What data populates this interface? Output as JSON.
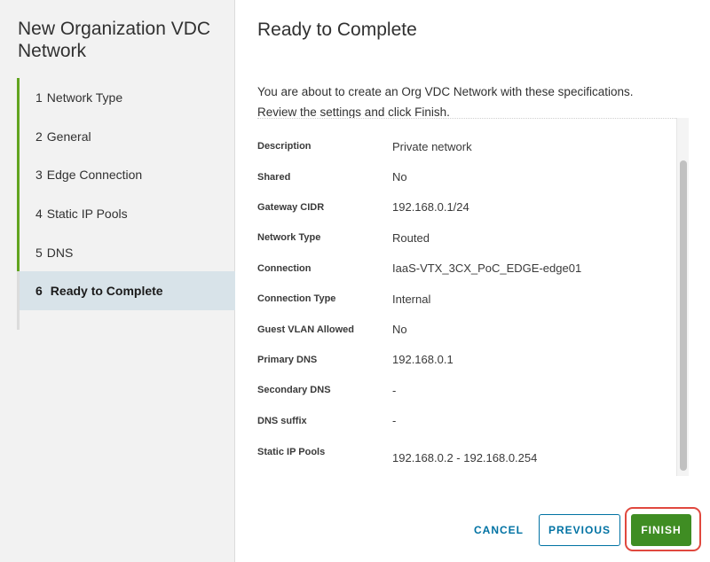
{
  "wizard": {
    "title": "New Organization VDC Network"
  },
  "steps": [
    {
      "num": "1",
      "label": "Network Type"
    },
    {
      "num": "2",
      "label": "General"
    },
    {
      "num": "3",
      "label": "Edge Connection"
    },
    {
      "num": "4",
      "label": "Static IP Pools"
    },
    {
      "num": "5",
      "label": "DNS"
    },
    {
      "num": "6",
      "label": "Ready to Complete"
    }
  ],
  "page": {
    "title": "Ready to Complete",
    "intro": "You are about to create an Org VDC Network with these specifications. Review the settings and click Finish."
  },
  "summary": [
    {
      "label": "Description",
      "value": "Private network"
    },
    {
      "label": "Shared",
      "value": "No"
    },
    {
      "label": "Gateway CIDR",
      "value": "192.168.0.1/24"
    },
    {
      "label": "Network Type",
      "value": "Routed"
    },
    {
      "label": "Connection",
      "value": "IaaS-VTX_3CX_PoC_EDGE-edge01"
    },
    {
      "label": "Connection Type",
      "value": "Internal"
    },
    {
      "label": "Guest VLAN Allowed",
      "value": "No"
    },
    {
      "label": "Primary DNS",
      "value": "192.168.0.1"
    },
    {
      "label": "Secondary DNS",
      "value": "-"
    },
    {
      "label": "DNS suffix",
      "value": "-"
    },
    {
      "label": "Static IP Pools",
      "value": "192.168.0.2 - 192.168.0.254"
    }
  ],
  "footer": {
    "cancel": "CANCEL",
    "previous": "PREVIOUS",
    "finish": "FINISH"
  },
  "colors": {
    "accent": "#0072a3",
    "finish": "#3f8d23",
    "step_complete": "#62a420",
    "highlight": "#e0483e"
  }
}
